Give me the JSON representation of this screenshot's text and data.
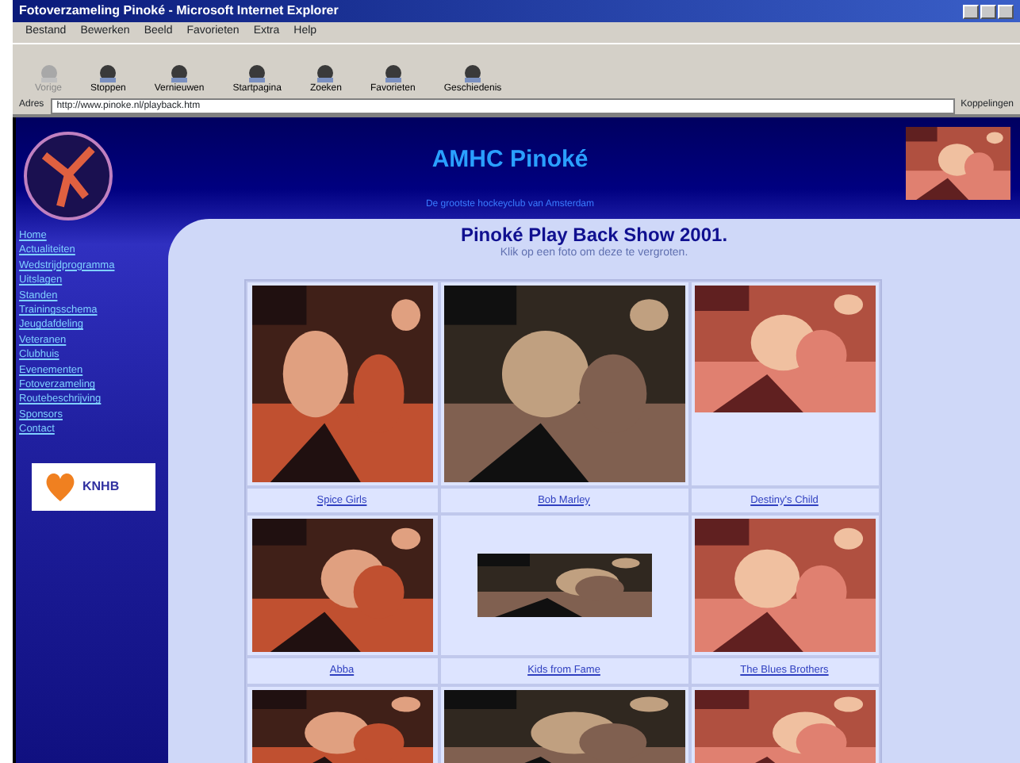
{
  "window": {
    "title": "Fotoverzameling Pinoké - Microsoft Internet Explorer"
  },
  "menu": [
    "Bestand",
    "Bewerken",
    "Beeld",
    "Favorieten",
    "Extra",
    "Help"
  ],
  "toolbar": [
    {
      "label": "Vorige",
      "disabled": true
    },
    {
      "label": "Stoppen",
      "disabled": false
    },
    {
      "label": "Vernieuwen",
      "disabled": false
    },
    {
      "label": "Startpagina",
      "disabled": false
    },
    {
      "label": "Zoeken",
      "disabled": false
    },
    {
      "label": "Favorieten",
      "disabled": false
    },
    {
      "label": "Geschiedenis",
      "disabled": false
    }
  ],
  "address": {
    "label": "Adres",
    "value": "http://www.pinoke.nl/playback.htm",
    "links": "Koppelingen"
  },
  "page": {
    "site_title": "AMHC  Pinoké",
    "tagline": "De grootste hockeyclub van Amsterdam",
    "nav": [
      "Home",
      "Actualiteiten",
      "Wedstrijdprogramma",
      "Uitslagen",
      "Standen",
      "Trainingsschema",
      "Jeugdafdeling",
      "Veteranen",
      "Clubhuis",
      "Evenementen",
      "Fotoverzameling",
      "Routebeschrijving",
      "Sponsors",
      "Contact"
    ],
    "heading": "Pinoké Play Back Show 2001.",
    "intro": "Klik op een foto om deze te vergroten.",
    "sponsor": "KNHB",
    "photos": [
      {
        "kind": "picture",
        "caption": "Spice Girls"
      },
      {
        "kind": "picture",
        "caption": "Bob Marley"
      },
      {
        "kind": "picture",
        "caption": "Destiny's Child"
      },
      {
        "kind": "picture",
        "caption": "Abba"
      },
      {
        "kind": "picture",
        "caption": "Kids from Fame"
      },
      {
        "kind": "picture",
        "caption": "The Blues Brothers"
      },
      {
        "kind": "picture"
      },
      {
        "kind": "picture"
      },
      {
        "kind": "picture"
      }
    ]
  }
}
